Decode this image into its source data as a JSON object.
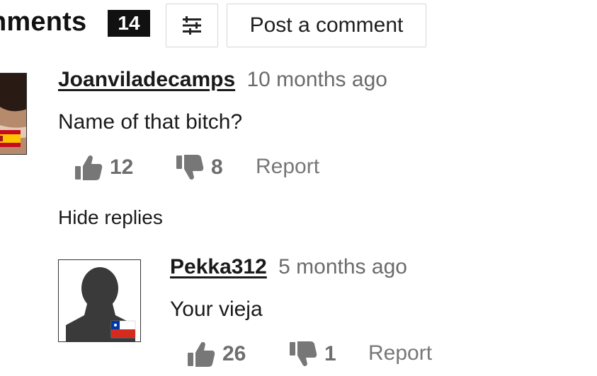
{
  "header": {
    "title": "nments",
    "count": "14",
    "post_button_label": "Post a comment",
    "filter_icon": "sliders-icon"
  },
  "comments": [
    {
      "author": "Joanviladecamps",
      "time": "10 months ago",
      "text": "Name of that bitch?",
      "likes": "12",
      "dislikes": "8",
      "report_label": "Report",
      "flag": "spain-flag-icon"
    }
  ],
  "hide_replies_label": "Hide replies",
  "replies": [
    {
      "author": "Pekka312",
      "time": "5 months ago",
      "text": "Your vieja",
      "likes": "26",
      "dislikes": "1",
      "report_label": "Report",
      "flag": "chile-flag-icon"
    }
  ],
  "colors": {
    "text": "#1a1a1a",
    "muted": "#6e6e6e",
    "badge_bg": "#111111",
    "border": "#d6d6d6"
  }
}
